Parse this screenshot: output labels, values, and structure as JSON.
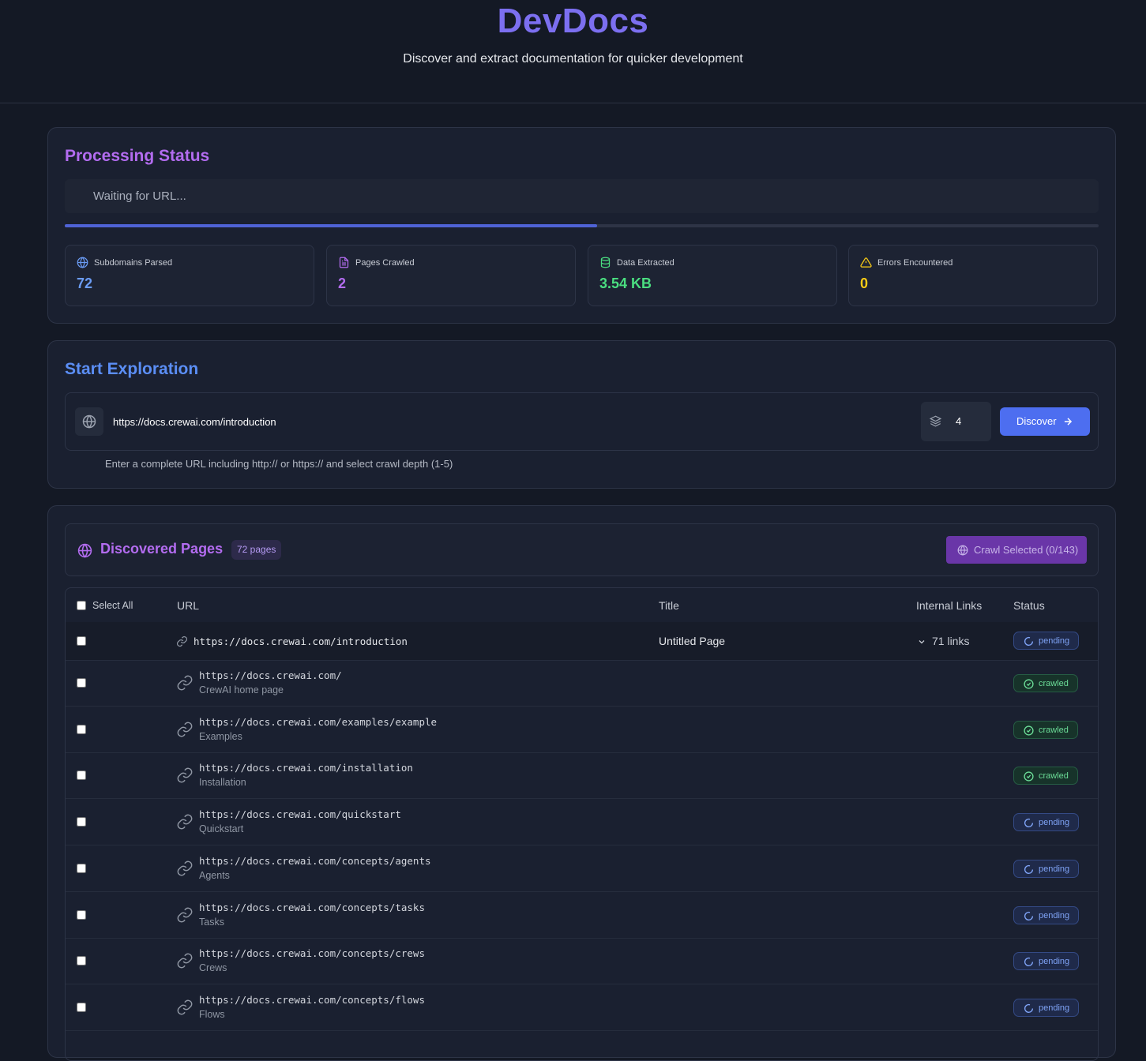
{
  "header": {
    "title": "DevDocs",
    "subtitle": "Discover and extract documentation for quicker development"
  },
  "status": {
    "title": "Processing Status",
    "message": "Waiting for URL...",
    "progress": 0.515,
    "stats": [
      {
        "label": "Subdomains Parsed",
        "value": "72",
        "icon": "globe-icon",
        "color": "#6b9cf5"
      },
      {
        "label": "Pages Crawled",
        "value": "2",
        "icon": "document-icon",
        "color": "#b36cf0"
      },
      {
        "label": "Data Extracted",
        "value": "3.54 KB",
        "icon": "database-icon",
        "color": "#4ade80"
      },
      {
        "label": "Errors Encountered",
        "value": "0",
        "icon": "warning-icon",
        "color": "#facc15"
      }
    ]
  },
  "explore": {
    "title": "Start Exploration",
    "url_value": "https://docs.crewai.com/introduction",
    "depth": "4",
    "discover_label": "Discover",
    "hint": "Enter a complete URL including http:// or https:// and select crawl depth (1-5)"
  },
  "pages": {
    "title": "Discovered Pages",
    "count_badge": "72 pages",
    "crawl_button": "Crawl Selected (0/143)",
    "columns": {
      "select_all": "Select All",
      "url": "URL",
      "title": "Title",
      "internal_links": "Internal Links",
      "status": "Status"
    },
    "first_row": {
      "url": "https://docs.crewai.com/introduction",
      "title": "Untitled Page",
      "links": "71 links",
      "status": "pending"
    },
    "rows": [
      {
        "url": "https://docs.crewai.com/",
        "desc": "CrewAI home page",
        "status": "crawled"
      },
      {
        "url": "https://docs.crewai.com/examples/example",
        "desc": "Examples",
        "status": "crawled"
      },
      {
        "url": "https://docs.crewai.com/installation",
        "desc": "Installation",
        "status": "crawled"
      },
      {
        "url": "https://docs.crewai.com/quickstart",
        "desc": "Quickstart",
        "status": "pending"
      },
      {
        "url": "https://docs.crewai.com/concepts/agents",
        "desc": "Agents",
        "status": "pending"
      },
      {
        "url": "https://docs.crewai.com/concepts/tasks",
        "desc": "Tasks",
        "status": "pending"
      },
      {
        "url": "https://docs.crewai.com/concepts/crews",
        "desc": "Crews",
        "status": "pending"
      },
      {
        "url": "https://docs.crewai.com/concepts/flows",
        "desc": "Flows",
        "status": "pending"
      }
    ]
  }
}
